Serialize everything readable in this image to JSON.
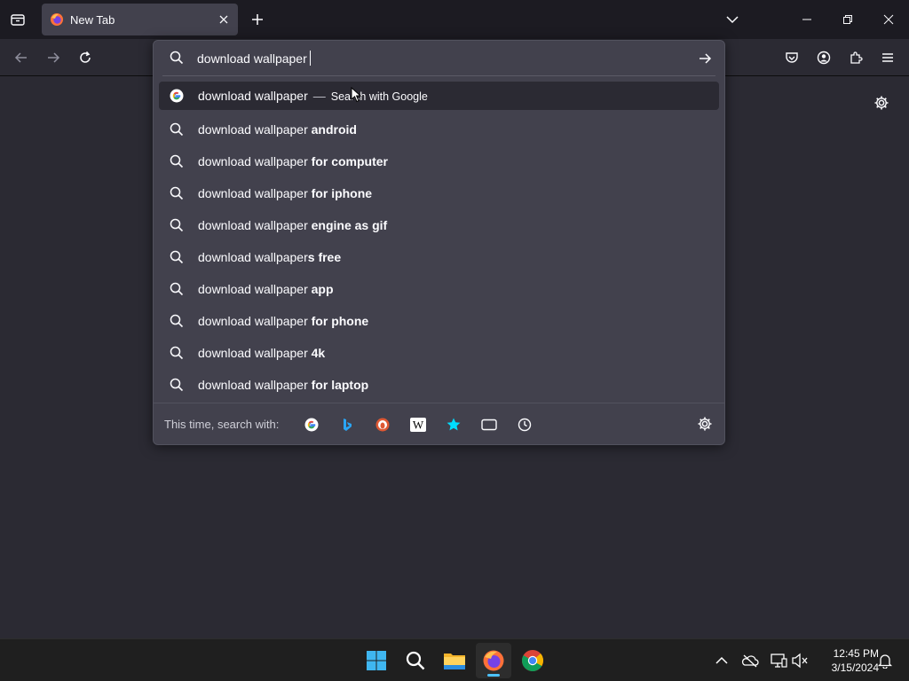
{
  "tabstrip": {
    "tab_manager_icon": "tab-manager-icon",
    "active_tab": {
      "title": "New Tab",
      "favicon": "firefox-logo-icon"
    },
    "new_tab_icon": "plus-icon",
    "list_all_tabs_icon": "chevron-down-icon",
    "window_controls": [
      "minimize-icon",
      "restore-icon",
      "close-icon"
    ]
  },
  "navbar": {
    "back_icon": "arrow-left-icon",
    "forward_icon": "arrow-right-icon",
    "reload_icon": "reload-icon",
    "right_icons": [
      "pocket-icon",
      "account-icon",
      "extensions-icon",
      "menu-icon"
    ]
  },
  "urlbar": {
    "value": "download wallpaper",
    "search_icon": "search-icon",
    "go_icon": "arrow-right-icon",
    "results": [
      {
        "prefix": "download wallpaper",
        "suffix": "",
        "type": "search-engine",
        "separator": "—",
        "action": "Search with Google",
        "icon": "google-icon",
        "selected": true
      },
      {
        "prefix": "download wallpaper ",
        "suffix": "android",
        "icon": "search-icon"
      },
      {
        "prefix": "download wallpaper ",
        "suffix": "for computer",
        "icon": "search-icon"
      },
      {
        "prefix": "download wallpaper ",
        "suffix": "for iphone",
        "icon": "search-icon"
      },
      {
        "prefix": "download wallpaper ",
        "suffix": "engine as gif",
        "icon": "search-icon"
      },
      {
        "prefix": "download wallpaper",
        "suffix": "s free",
        "icon": "search-icon"
      },
      {
        "prefix": "download wallpaper ",
        "suffix": "app",
        "icon": "search-icon"
      },
      {
        "prefix": "download wallpaper ",
        "suffix": "for phone",
        "icon": "search-icon"
      },
      {
        "prefix": "download wallpaper ",
        "suffix": "4k",
        "icon": "search-icon"
      },
      {
        "prefix": "download wallpaper ",
        "suffix": "for laptop",
        "icon": "search-icon"
      }
    ],
    "one_off": {
      "label": "This time, search with:",
      "engines": [
        "google-icon",
        "bing-icon",
        "duckduckgo-icon",
        "wikipedia-icon",
        "bookmarks-star-icon",
        "tabs-icon",
        "history-clock-icon"
      ],
      "settings_icon": "gear-icon"
    }
  },
  "page": {
    "settings_icon": "gear-icon"
  },
  "taskbar": {
    "apps": [
      "windows-start-icon",
      "search-icon",
      "file-explorer-icon",
      "firefox-icon",
      "chrome-icon"
    ],
    "active_app": "firefox-icon",
    "tray": [
      "chevron-up-icon",
      "onedrive-icon",
      "network-icon",
      "volume-muted-icon"
    ],
    "time": "12:45 PM",
    "date": "3/15/2024",
    "notification_icon": "bell-icon"
  },
  "colors": {
    "chrome_bg": "#1c1b22",
    "toolbar_bg": "#2b2a33",
    "popup_bg": "#42414d",
    "taskbar_bg": "#1f1f1f",
    "accent": "#4cc2ff"
  }
}
